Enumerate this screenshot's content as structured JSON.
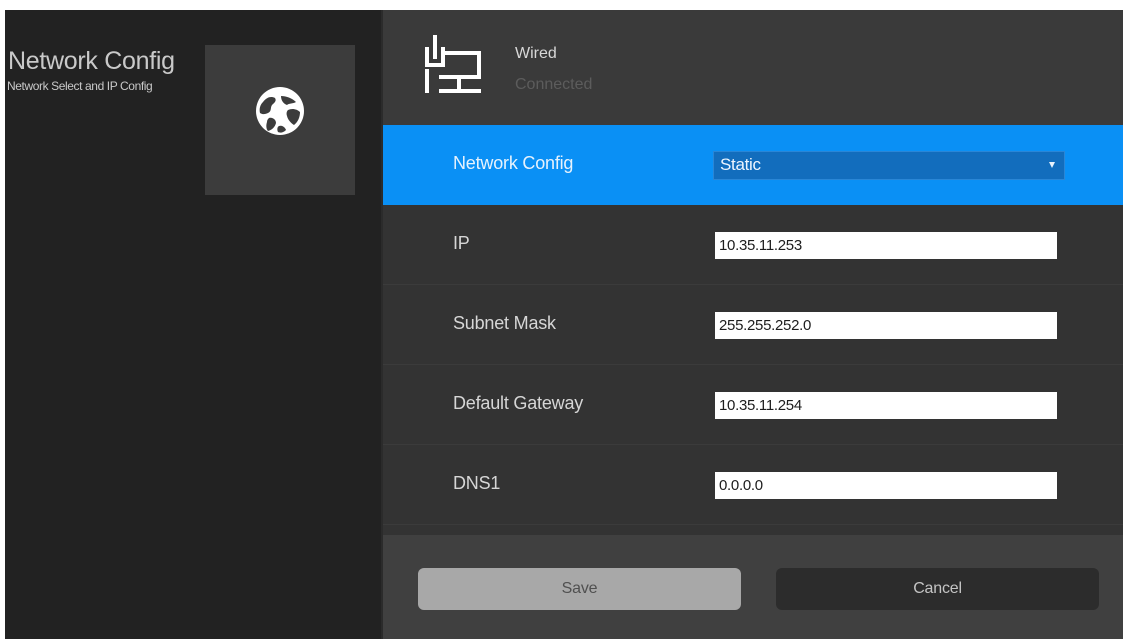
{
  "app": {
    "title": "Network Config",
    "subtitle": "Network Select and IP Config",
    "tile_icon": "globe-icon"
  },
  "connection": {
    "icon": "ethernet-icon",
    "name": "Wired",
    "status": "Connected"
  },
  "form": {
    "network_config": {
      "label": "Network Config",
      "value": "Static",
      "options": [
        "Static"
      ]
    },
    "ip": {
      "label": "IP",
      "value": "10.35.11.253"
    },
    "subnet_mask": {
      "label": "Subnet Mask",
      "value": "255.255.252.0"
    },
    "default_gateway": {
      "label": "Default Gateway",
      "value": "10.35.11.254"
    },
    "dns1": {
      "label": "DNS1",
      "value": "0.0.0.0"
    }
  },
  "actions": {
    "save_label": "Save",
    "cancel_label": "Cancel"
  },
  "colors": {
    "accent": "#0a90f5",
    "select_fill": "#126dbd",
    "left_panel": "#222222",
    "right_panel": "#333333",
    "header": "#3a3a3a",
    "footer": "#404040"
  }
}
